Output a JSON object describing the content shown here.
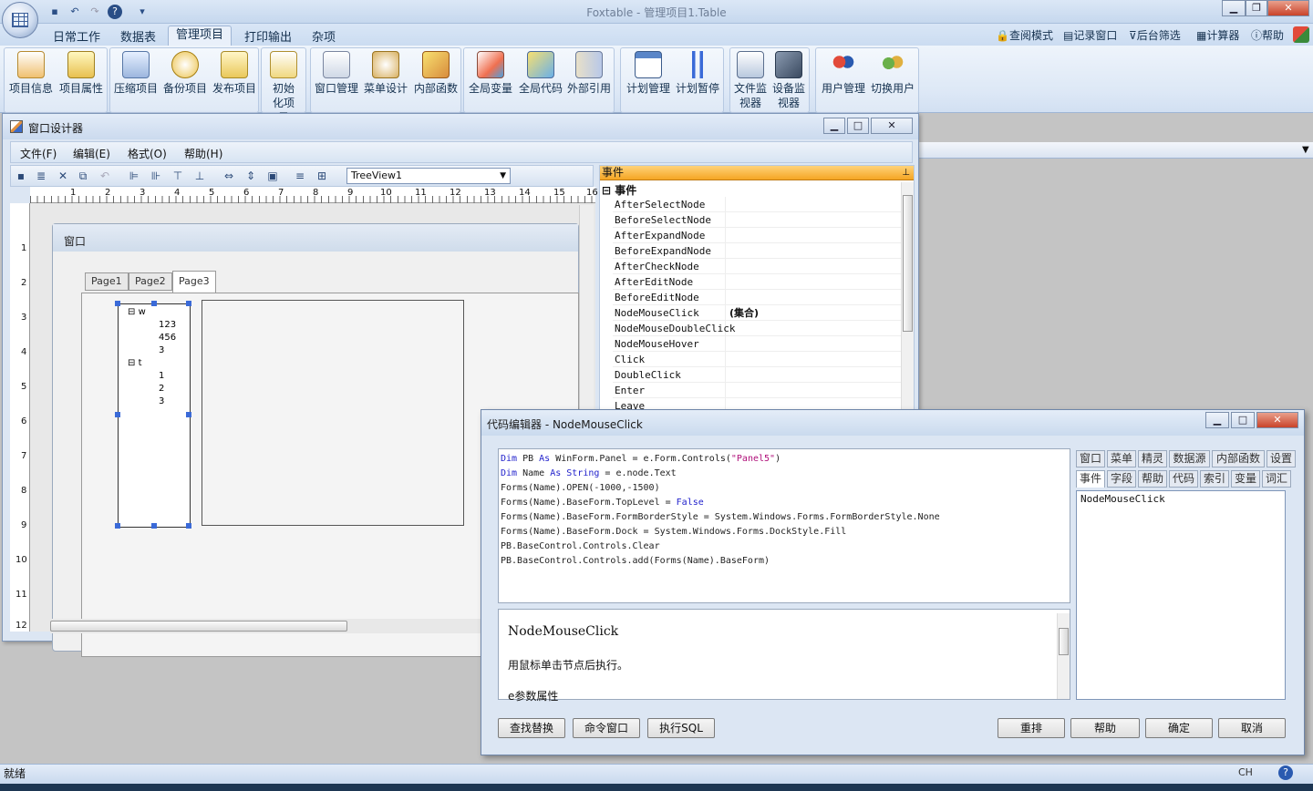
{
  "app": {
    "title": "Foxtable - 管理项目1.Table"
  },
  "ribbon": {
    "tabs": [
      "日常工作",
      "数据表",
      "管理项目",
      "打印输出",
      "杂项"
    ],
    "active_tab": "管理项目",
    "tools": [
      "查阅模式",
      "记录窗口",
      "后台筛选",
      "计算器",
      "帮助"
    ],
    "buttons": [
      "项目信息",
      "项目属性",
      "压缩项目",
      "备份项目",
      "发布项目",
      "初始化项目",
      "窗口管理",
      "菜单设计",
      "内部函数",
      "全局变量",
      "全局代码",
      "外部引用",
      "计划管理",
      "计划暂停",
      "文件监视器",
      "设备监视器",
      "用户管理",
      "切换用户"
    ]
  },
  "designer": {
    "title": "窗口设计器",
    "menu": [
      "文件(F)",
      "编辑(E)",
      "格式(O)",
      "帮助(H)"
    ],
    "control_combo": "TreeView1",
    "ruler_h": [
      "1",
      "2",
      "3",
      "4",
      "5",
      "6",
      "7",
      "8",
      "9",
      "10",
      "11",
      "12",
      "13",
      "14",
      "15",
      "16"
    ],
    "ruler_v": [
      "1",
      "2",
      "3",
      "4",
      "5",
      "6",
      "7",
      "8",
      "9",
      "10",
      "11",
      "12"
    ],
    "form_caption": "窗口",
    "pages": [
      "Page1",
      "Page2",
      "Page3"
    ],
    "tree": [
      "w",
      "123",
      "456",
      "3",
      "t",
      "1",
      "2",
      "3"
    ]
  },
  "events": {
    "header": "事件",
    "category": "事件",
    "rows": [
      {
        "name": "AfterSelectNode",
        "value": ""
      },
      {
        "name": "BeforeSelectNode",
        "value": ""
      },
      {
        "name": "AfterExpandNode",
        "value": ""
      },
      {
        "name": "BeforeExpandNode",
        "value": ""
      },
      {
        "name": "AfterCheckNode",
        "value": ""
      },
      {
        "name": "AfterEditNode",
        "value": ""
      },
      {
        "name": "BeforeEditNode",
        "value": ""
      },
      {
        "name": "NodeMouseClick",
        "value": "(集合)"
      },
      {
        "name": "NodeMouseDoubleClick",
        "value": ""
      },
      {
        "name": "NodeMouseHover",
        "value": ""
      },
      {
        "name": "Click",
        "value": ""
      },
      {
        "name": "DoubleClick",
        "value": ""
      },
      {
        "name": "Enter",
        "value": ""
      },
      {
        "name": "Leave",
        "value": ""
      }
    ]
  },
  "code_editor": {
    "title": "代码编辑器 - NodeMouseClick",
    "lines": [
      "Dim PB As WinForm.Panel = e.Form.Controls(\"Panel5\")",
      "Dim Name As String = e.node.Text",
      "Forms(Name).OPEN(-1000,-1500)",
      "Forms(Name).BaseForm.TopLevel = False",
      "Forms(Name).BaseForm.FormBorderStyle = System.Windows.Forms.FormBorderStyle.None",
      "Forms(Name).BaseForm.Dock = System.Windows.Forms.DockStyle.Fill",
      "PB.BaseControl.Controls.Clear",
      "PB.BaseControl.Controls.add(Forms(Name).BaseForm)"
    ],
    "help_title": "NodeMouseClick",
    "help_text": "用鼠标单击节点后执行。",
    "help_param": "e参数属性",
    "side_tabs_row1": [
      "窗口",
      "菜单",
      "精灵",
      "数据源",
      "内部函数",
      "设置"
    ],
    "side_tabs_row2": [
      "事件",
      "字段",
      "帮助",
      "代码",
      "索引",
      "变量",
      "词汇"
    ],
    "side_list": [
      "NodeMouseClick"
    ],
    "buttons_left": [
      "查找替换",
      "命令窗口",
      "执行SQL"
    ],
    "buttons_right": [
      "重排",
      "帮助",
      "确定",
      "取消"
    ]
  },
  "status": {
    "text": "就绪",
    "lang": "CH"
  }
}
